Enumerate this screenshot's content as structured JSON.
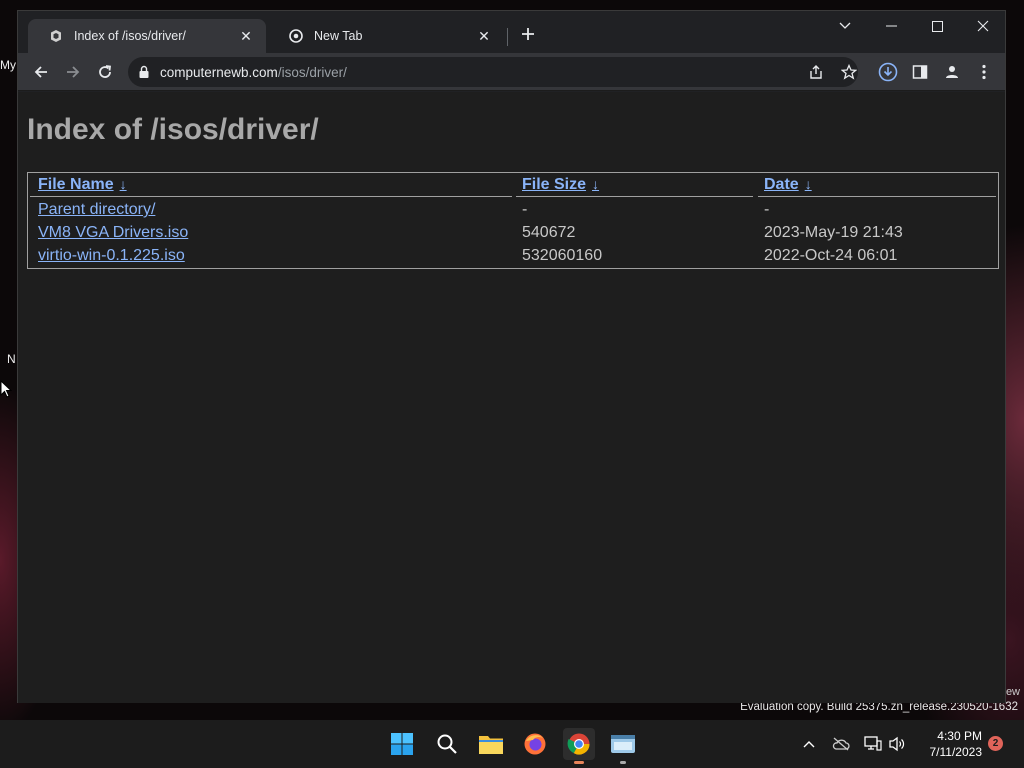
{
  "desktop": {
    "left_label_1": "My",
    "left_label_2": "N",
    "right_label": "ew",
    "watermark": "Evaluation copy. Build 25375.zn_release.230520-1632"
  },
  "browser": {
    "tabs": [
      {
        "title": "Index of /isos/driver/",
        "active": true,
        "icon": "page-favicon-icon"
      },
      {
        "title": "New Tab",
        "active": false,
        "icon": "chrome-icon"
      }
    ],
    "address": {
      "domain": "computernewb.com",
      "path": "/isos/driver/"
    }
  },
  "page": {
    "heading": "Index of /isos/driver/",
    "columns": [
      {
        "label": "File Name",
        "sort": "↓"
      },
      {
        "label": "File Size",
        "sort": "↓"
      },
      {
        "label": "Date",
        "sort": "↓"
      }
    ],
    "rows": [
      {
        "name": "Parent directory/",
        "size": "-",
        "date": "-"
      },
      {
        "name": "VM8 VGA Drivers.iso",
        "size": "540672",
        "date": "2023-May-19 21:43"
      },
      {
        "name": "virtio-win-0.1.225.iso",
        "size": "532060160",
        "date": "2022-Oct-24 06:01"
      }
    ]
  },
  "taskbar": {
    "time": "4:30 PM",
    "date": "7/11/2023",
    "notification_count": "2"
  },
  "colors": {
    "link": "#8ab4f8",
    "page_bg": "#1e1e1e",
    "heading": "#a8a8a8"
  }
}
